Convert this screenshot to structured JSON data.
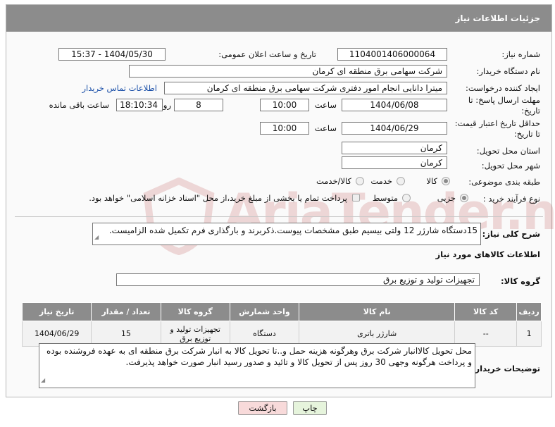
{
  "header": {
    "title": "جزئیات اطلاعات نیاز"
  },
  "fields": {
    "need_number_label": "شماره نیاز:",
    "need_number": "1104001406000064",
    "announce_label": "تاریخ و ساعت اعلان عمومی:",
    "announce_value": "1404/05/30 - 15:37",
    "buyer_label": "نام دستگاه خریدار:",
    "buyer_value": "شرکت سهامی برق منطقه ای کرمان",
    "creator_label": "ایجاد کننده درخواست:",
    "creator_value": "میترا دانایی انجام امور دفتری شرکت سهامی برق منطقه ای کرمان",
    "buyer_contact_link": "اطلاعات تماس خریدار",
    "deadline_label_1": "مهلت ارسال پاسخ: تا",
    "deadline_label_2": "تاریخ:",
    "deadline_date": "1404/06/08",
    "hour_label": "ساعت",
    "deadline_time": "10:00",
    "days_value": "8",
    "days_label": "روز و",
    "remaining_time": "18:10:34",
    "remaining_label": "ساعت باقی مانده",
    "price_label_1": "حداقل تاریخ اعتبار قیمت:",
    "price_label_2": "تا تاریخ:",
    "price_date": "1404/06/29",
    "price_hour_label": "ساعت",
    "price_time": "10:00",
    "province_label": "استان محل تحویل:",
    "province_value": "کرمان",
    "city_label": "شهر محل تحویل:",
    "city_value": "کرمان",
    "category_label": "طبقه بندی موضوعی:",
    "category_options": [
      "کالا",
      "خدمت",
      "کالا/خدمت"
    ],
    "process_label": "نوع فرآیند خرید :",
    "process_options": [
      "جزیی",
      "متوسط"
    ],
    "payment_note": "پرداخت تمام یا بخشی از مبلغ خرید،از محل \"اسناد خزانه اسلامی\" خواهد بود."
  },
  "summary": {
    "label": "شرح کلی نیاز:",
    "value": "15دستگاه شارژر 12 ولتی بیسیم طبق مشخصات پیوست.ذکربرند و بارگذاری فرم تکمیل شده الزامیست."
  },
  "goods": {
    "section_title": "اطلاعات کالاهای مورد نیاز",
    "group_label": "گروه کالا:",
    "group_value": "تجهیزات تولید و توزیع برق",
    "columns": [
      "ردیف",
      "کد کالا",
      "نام کالا",
      "واحد شمارش",
      "گروه کالا",
      "تعداد / مقدار",
      "تاریخ نیاز"
    ],
    "rows": [
      [
        "1",
        "--",
        "شارژر باتری",
        "دستگاه",
        "تجهیزات تولید و توزیع برق",
        "15",
        "1404/06/29"
      ]
    ]
  },
  "buyer_notes": {
    "label": "توضیحات خریدار:",
    "value": "محل تحویل کالاانبار شرکت برق وهرگونه هزینه حمل و..تا تحویل کالا به انبار شرکت برق منطقه ای به عهده فروشنده بوده و پرداخت هرگونه وجهی 30 روز پس از تحویل کالا و تائید و صدور رسید انبار صورت خواهد پذیرفت."
  },
  "buttons": {
    "print": "چاپ",
    "back": "بازگشت"
  },
  "watermark_text": "AriaTender.neT",
  "colors": {
    "header_bg": "#8c8c8c",
    "link": "#1a4fa8",
    "back_btn": "#f8dada",
    "print_btn": "#e6f4dc"
  }
}
